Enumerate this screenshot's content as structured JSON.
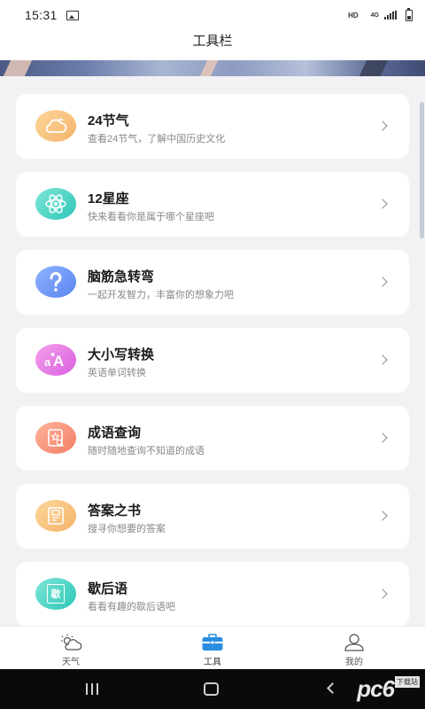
{
  "status": {
    "time": "15:31",
    "hd": "HD",
    "network": "4G"
  },
  "header": {
    "title": "工具栏"
  },
  "tools": [
    {
      "title": "24节气",
      "subtitle": "查看24节气，了解中国历史文化",
      "icon": "cloud-icon",
      "color_from": "#fcd79a",
      "color_to": "#f5b26b"
    },
    {
      "title": "12星座",
      "subtitle": "快来看看你是属于哪个星座吧",
      "icon": "atom-icon",
      "color_from": "#7fe6d6",
      "color_to": "#2cc7b8"
    },
    {
      "title": "脑筋急转弯",
      "subtitle": "一起开发智力，丰富你的想象力吧",
      "icon": "question-icon",
      "color_from": "#8fb3ff",
      "color_to": "#5a84f0"
    },
    {
      "title": "大小写转换",
      "subtitle": "英语单词转换",
      "icon": "letter-case-icon",
      "color_from": "#f5a0ea",
      "color_to": "#d85fe0"
    },
    {
      "title": "成语查询",
      "subtitle": "随时随地查询不知道的成语",
      "icon": "search-book-icon",
      "color_from": "#ffb49a",
      "color_to": "#f27d66"
    },
    {
      "title": "答案之书",
      "subtitle": "搜寻你想要的答案",
      "icon": "book-icon",
      "color_from": "#fcd79a",
      "color_to": "#f5b26b"
    },
    {
      "title": "歇后语",
      "subtitle": "看看有趣的歇后语吧",
      "icon": "xie-book-icon",
      "glyph": "歇",
      "color_from": "#7fe6d6",
      "color_to": "#2cc7b8"
    }
  ],
  "tabs": [
    {
      "label": "天气",
      "icon": "weather-icon",
      "active": false
    },
    {
      "label": "工具",
      "icon": "toolbox-icon",
      "active": true
    },
    {
      "label": "我的",
      "icon": "profile-icon",
      "active": false
    }
  ],
  "watermark": {
    "main": "pc6",
    "sub": "下载站"
  }
}
